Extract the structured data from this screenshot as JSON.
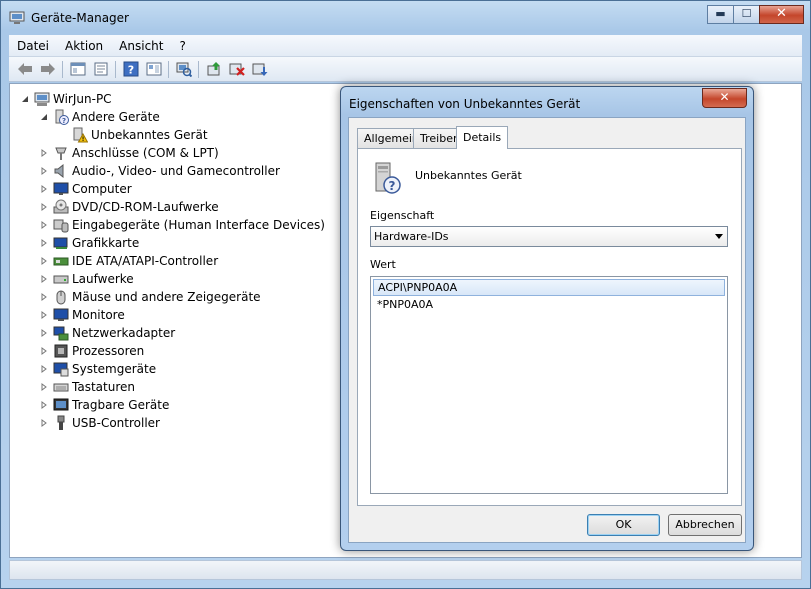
{
  "window": {
    "title": "Geräte-Manager",
    "controls": {
      "minimize": "▬",
      "maximize": "☐",
      "close": "✕"
    }
  },
  "menu": [
    "Datei",
    "Aktion",
    "Ansicht",
    "?"
  ],
  "toolbar_icons": [
    "back-arrow-icon",
    "forward-arrow-icon",
    "sep",
    "console-icon",
    "properties-icon",
    "sep",
    "help-icon",
    "view-icon",
    "sep",
    "scan-hardware-icon",
    "sep",
    "update-driver-icon",
    "disable-device-icon",
    "uninstall-device-icon"
  ],
  "tree": {
    "root": "WirJun-PC",
    "other_devices": "Andere Geräte",
    "unknown_device": "Unbekanntes Gerät",
    "categories": [
      "Anschlüsse (COM & LPT)",
      "Audio-, Video- und Gamecontroller",
      "Computer",
      "DVD/CD-ROM-Laufwerke",
      "Eingabegeräte (Human Interface Devices)",
      "Grafikkarte",
      "IDE ATA/ATAPI-Controller",
      "Laufwerke",
      "Mäuse und andere Zeigegeräte",
      "Monitore",
      "Netzwerkadapter",
      "Prozessoren",
      "Systemgeräte",
      "Tastaturen",
      "Tragbare Geräte",
      "USB-Controller"
    ]
  },
  "dialog": {
    "title": "Eigenschaften von Unbekanntes Gerät",
    "close": "✕",
    "tabs": [
      "Allgemein",
      "Treiber",
      "Details"
    ],
    "device_name": "Unbekanntes Gerät",
    "property_label": "Eigenschaft",
    "property_value": "Hardware-IDs",
    "value_label": "Wert",
    "values": [
      "ACPI\\PNP0A0A",
      "*PNP0A0A"
    ],
    "ok": "OK",
    "cancel": "Abbrechen"
  }
}
